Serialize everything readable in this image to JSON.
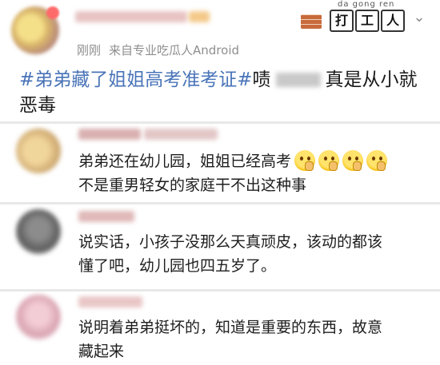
{
  "post": {
    "meta_time": "刚刚",
    "meta_source": "来自专业吃瓜人Android",
    "text_tag": "#弟弟藏了姐姐高考准考证#",
    "text_pre": "啧",
    "text_rest": "真是从小就恶毒",
    "more_icon": "chevron-down-icon"
  },
  "watermark": {
    "pinyin": "da  gong  ren",
    "chars": [
      "打",
      "工",
      "人"
    ]
  },
  "comments": [
    {
      "line1": "弟弟还在幼儿园，姐姐已经高考",
      "line2": "不是重男轻女的家庭干不出这种事",
      "emoji_count": 4
    },
    {
      "line1": "说实话，小孩子没那么天真顽皮，该动的都该",
      "line2": "懂了吧，幼儿园也四五岁了。"
    },
    {
      "line1": "说明着弟弟挺坏的，知道是重要的东西，故意",
      "line2": "藏起来"
    }
  ],
  "colors": {
    "tag": "#4a74b8",
    "meta": "#8f8f8f",
    "divider": "#e8e8e8"
  }
}
